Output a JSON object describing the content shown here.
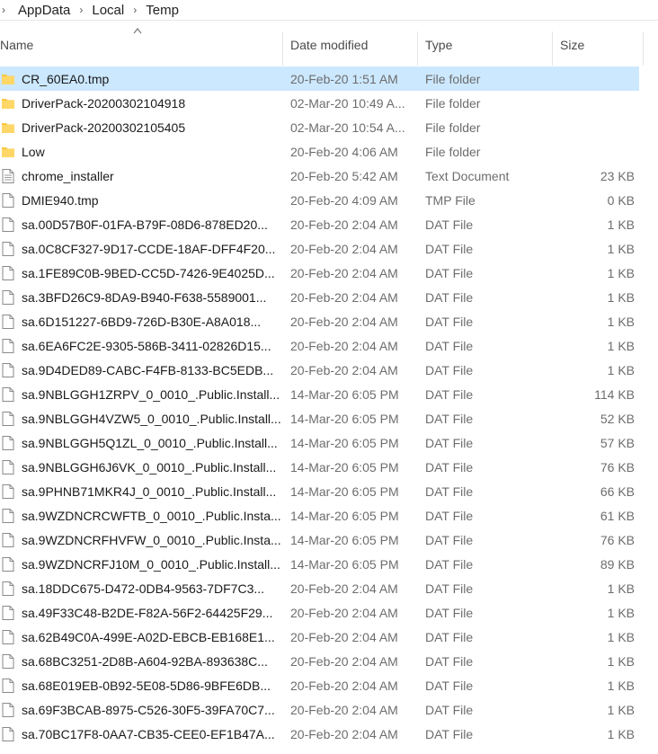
{
  "breadcrumb": [
    "AppData",
    "Local",
    "Temp"
  ],
  "columns": {
    "name": "Name",
    "date": "Date modified",
    "type": "Type",
    "size": "Size"
  },
  "rows": [
    {
      "name": "CR_60EA0.tmp",
      "date": "20-Feb-20 1:51 AM",
      "type": "File folder",
      "size": "",
      "icon": "folder-icon",
      "selected": true
    },
    {
      "name": "DriverPack-20200302104918",
      "date": "02-Mar-20 10:49 A...",
      "type": "File folder",
      "size": "",
      "icon": "folder-icon"
    },
    {
      "name": "DriverPack-20200302105405",
      "date": "02-Mar-20 10:54 A...",
      "type": "File folder",
      "size": "",
      "icon": "folder-icon"
    },
    {
      "name": "Low",
      "date": "20-Feb-20 4:06 AM",
      "type": "File folder",
      "size": "",
      "icon": "folder-icon"
    },
    {
      "name": "chrome_installer",
      "date": "20-Feb-20 5:42 AM",
      "type": "Text Document",
      "size": "23 KB",
      "icon": "text-document-icon"
    },
    {
      "name": "DMIE940.tmp",
      "date": "20-Feb-20 4:09 AM",
      "type": "TMP File",
      "size": "0 KB",
      "icon": "file-icon"
    },
    {
      "name": "sa.00D57B0F-01FA-B79F-08D6-878ED20...",
      "date": "20-Feb-20 2:04 AM",
      "type": "DAT File",
      "size": "1 KB",
      "icon": "file-icon"
    },
    {
      "name": "sa.0C8CF327-9D17-CCDE-18AF-DFF4F20...",
      "date": "20-Feb-20 2:04 AM",
      "type": "DAT File",
      "size": "1 KB",
      "icon": "file-icon"
    },
    {
      "name": "sa.1FE89C0B-9BED-CC5D-7426-9E4025D...",
      "date": "20-Feb-20 2:04 AM",
      "type": "DAT File",
      "size": "1 KB",
      "icon": "file-icon"
    },
    {
      "name": "sa.3BFD26C9-8DA9-B940-F638-5589001...",
      "date": "20-Feb-20 2:04 AM",
      "type": "DAT File",
      "size": "1 KB",
      "icon": "file-icon"
    },
    {
      "name": "sa.6D151227-6BD9-726D-B30E-A8A018...",
      "date": "20-Feb-20 2:04 AM",
      "type": "DAT File",
      "size": "1 KB",
      "icon": "file-icon"
    },
    {
      "name": "sa.6EA6FC2E-9305-586B-3411-02826D15...",
      "date": "20-Feb-20 2:04 AM",
      "type": "DAT File",
      "size": "1 KB",
      "icon": "file-icon"
    },
    {
      "name": "sa.9D4DED89-CABC-F4FB-8133-BC5EDB...",
      "date": "20-Feb-20 2:04 AM",
      "type": "DAT File",
      "size": "1 KB",
      "icon": "file-icon"
    },
    {
      "name": "sa.9NBLGGH1ZRPV_0_0010_.Public.Install...",
      "date": "14-Mar-20 6:05 PM",
      "type": "DAT File",
      "size": "114 KB",
      "icon": "file-icon"
    },
    {
      "name": "sa.9NBLGGH4VZW5_0_0010_.Public.Install...",
      "date": "14-Mar-20 6:05 PM",
      "type": "DAT File",
      "size": "52 KB",
      "icon": "file-icon"
    },
    {
      "name": "sa.9NBLGGH5Q1ZL_0_0010_.Public.Install...",
      "date": "14-Mar-20 6:05 PM",
      "type": "DAT File",
      "size": "57 KB",
      "icon": "file-icon"
    },
    {
      "name": "sa.9NBLGGH6J6VK_0_0010_.Public.Install...",
      "date": "14-Mar-20 6:05 PM",
      "type": "DAT File",
      "size": "76 KB",
      "icon": "file-icon"
    },
    {
      "name": "sa.9PHNB71MKR4J_0_0010_.Public.Install...",
      "date": "14-Mar-20 6:05 PM",
      "type": "DAT File",
      "size": "66 KB",
      "icon": "file-icon"
    },
    {
      "name": "sa.9WZDNCRCWFTB_0_0010_.Public.Insta...",
      "date": "14-Mar-20 6:05 PM",
      "type": "DAT File",
      "size": "61 KB",
      "icon": "file-icon"
    },
    {
      "name": "sa.9WZDNCRFHVFW_0_0010_.Public.Insta...",
      "date": "14-Mar-20 6:05 PM",
      "type": "DAT File",
      "size": "76 KB",
      "icon": "file-icon"
    },
    {
      "name": "sa.9WZDNCRFJ10M_0_0010_.Public.Install...",
      "date": "14-Mar-20 6:05 PM",
      "type": "DAT File",
      "size": "89 KB",
      "icon": "file-icon"
    },
    {
      "name": "sa.18DDC675-D472-0DB4-9563-7DF7C3...",
      "date": "20-Feb-20 2:04 AM",
      "type": "DAT File",
      "size": "1 KB",
      "icon": "file-icon"
    },
    {
      "name": "sa.49F33C48-B2DE-F82A-56F2-64425F29...",
      "date": "20-Feb-20 2:04 AM",
      "type": "DAT File",
      "size": "1 KB",
      "icon": "file-icon"
    },
    {
      "name": "sa.62B49C0A-499E-A02D-EBCB-EB168E1...",
      "date": "20-Feb-20 2:04 AM",
      "type": "DAT File",
      "size": "1 KB",
      "icon": "file-icon"
    },
    {
      "name": "sa.68BC3251-2D8B-A604-92BA-893638C...",
      "date": "20-Feb-20 2:04 AM",
      "type": "DAT File",
      "size": "1 KB",
      "icon": "file-icon"
    },
    {
      "name": "sa.68E019EB-0B92-5E08-5D86-9BFE6DB...",
      "date": "20-Feb-20 2:04 AM",
      "type": "DAT File",
      "size": "1 KB",
      "icon": "file-icon"
    },
    {
      "name": "sa.69F3BCAB-8975-C526-30F5-39FA70C7...",
      "date": "20-Feb-20 2:04 AM",
      "type": "DAT File",
      "size": "1 KB",
      "icon": "file-icon"
    },
    {
      "name": "sa.70BC17F8-0AA7-CB35-CEE0-EF1B47A...",
      "date": "20-Feb-20 2:04 AM",
      "type": "DAT File",
      "size": "1 KB",
      "icon": "file-icon"
    }
  ],
  "colors": {
    "folder": "#f8c840",
    "selection": "#cce8ff",
    "secondary_text": "#6d6d6d"
  }
}
